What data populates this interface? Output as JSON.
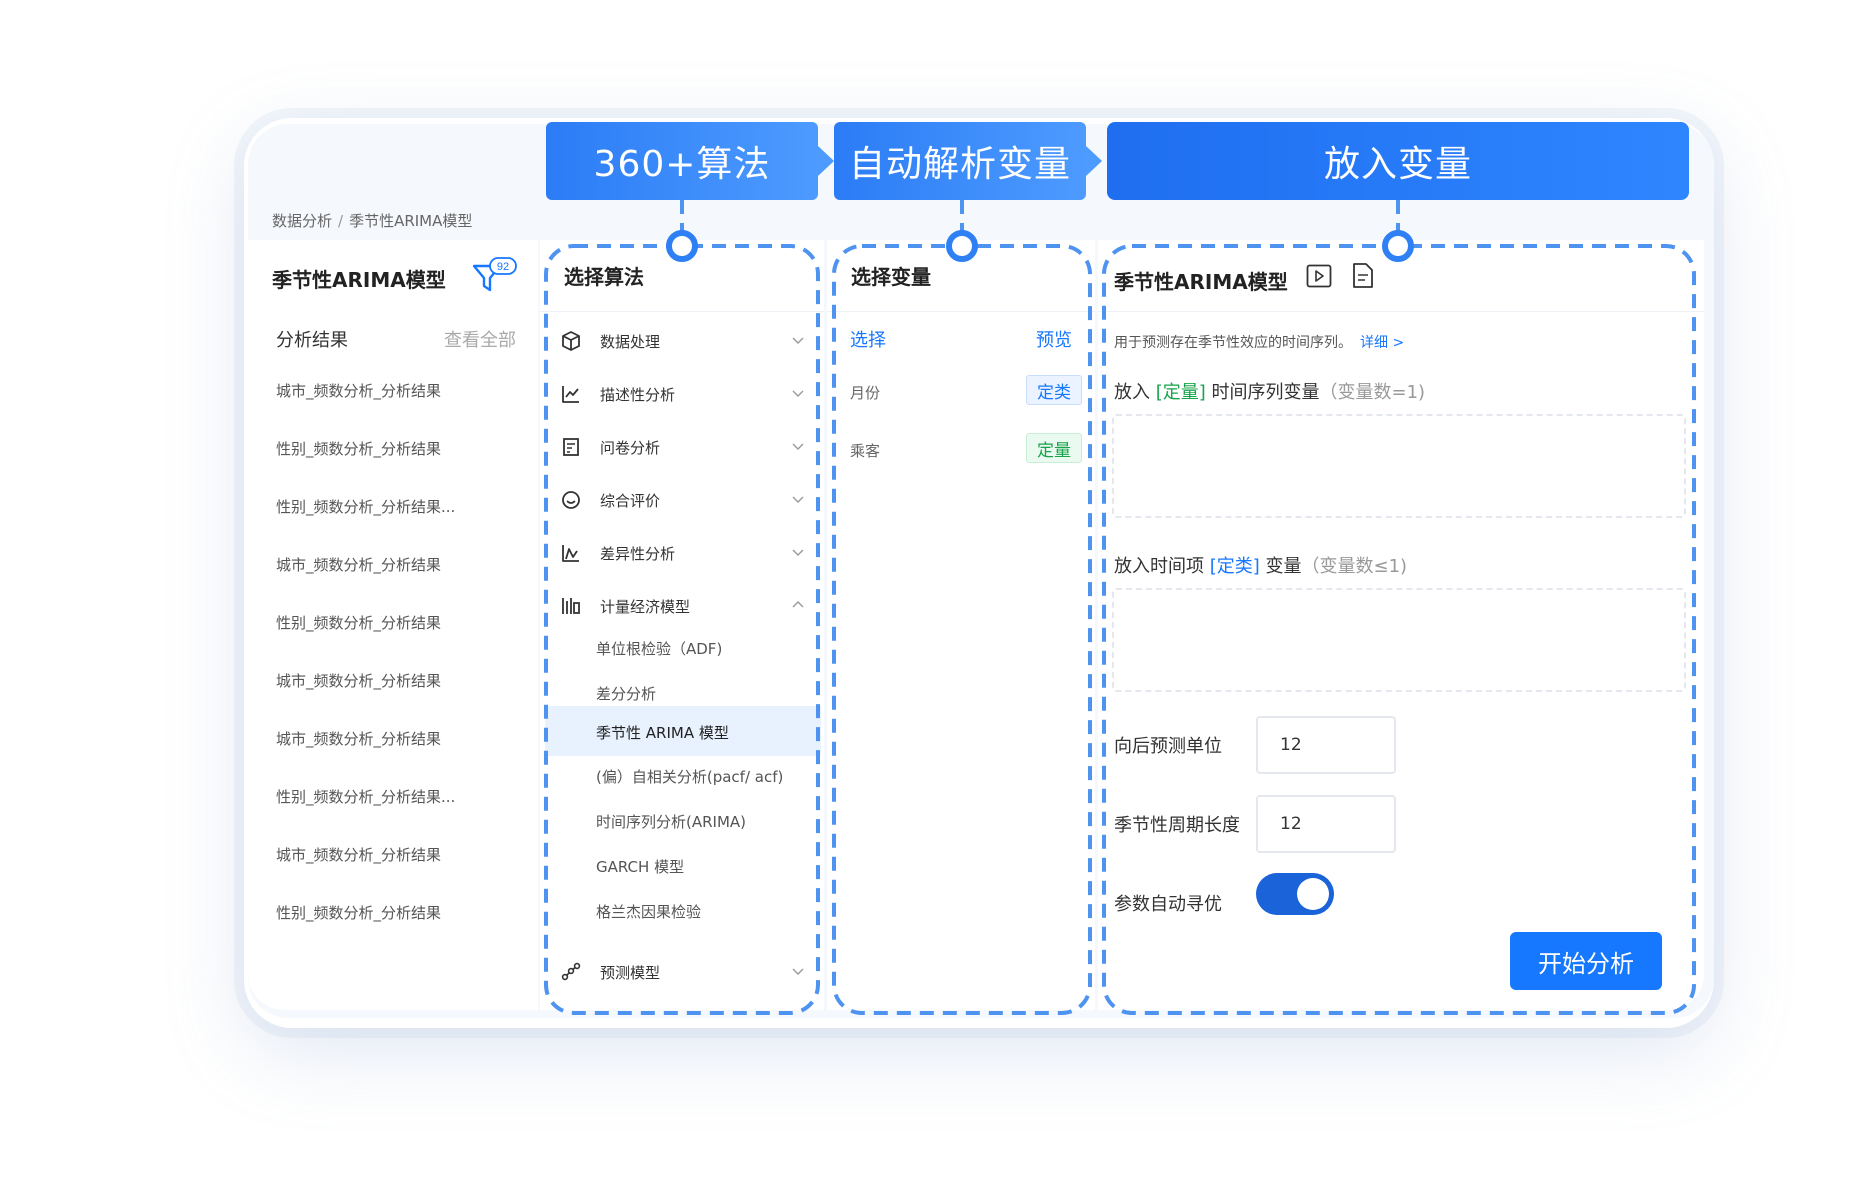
{
  "breadcrumb": {
    "root": "数据分析",
    "separator": "/",
    "current": "季节性ARIMA模型"
  },
  "banners": [
    "360+算法",
    "自动解析变量",
    "放入变量"
  ],
  "left": {
    "title": "季节性ARIMA模型",
    "badge": "92",
    "subtitle": "分析结果",
    "view_all": "查看全部",
    "items": [
      "城市_频数分析_分析结果",
      "性别_频数分析_分析结果",
      "性别_频数分析_分析结果...",
      "城市_频数分析_分析结果",
      "性别_频数分析_分析结果",
      "城市_频数分析_分析结果",
      "城市_频数分析_分析结果",
      "性别_频数分析_分析结果...",
      "城市_频数分析_分析结果",
      "性别_频数分析_分析结果"
    ]
  },
  "algorithms": {
    "title": "选择算法",
    "groups": [
      {
        "label": "数据处理",
        "icon": "cube-icon"
      },
      {
        "label": "描述性分析",
        "icon": "line-chart-icon"
      },
      {
        "label": "问卷分析",
        "icon": "questionnaire-icon"
      },
      {
        "label": "综合评价",
        "icon": "chat-icon"
      },
      {
        "label": "差异性分析",
        "icon": "difference-icon"
      },
      {
        "label": "计量经济模型",
        "icon": "econometrics-icon"
      }
    ],
    "sub_items": [
      "单位根检验（ADF)",
      "差分分析",
      "季节性 ARIMA 模型",
      "(偏）自相关分析(pacf/ acf)",
      "时间序列分析(ARIMA)",
      "GARCH 模型",
      "格兰杰因果检验"
    ],
    "last_group": {
      "label": "预测模型",
      "icon": "scatter-icon"
    }
  },
  "variables": {
    "title": "选择变量",
    "select": "选择",
    "preview": "预览",
    "items": [
      {
        "name": "月份",
        "tag": "定类"
      },
      {
        "name": "乘客",
        "tag": "定量"
      }
    ]
  },
  "main": {
    "title": "季节性ARIMA模型",
    "description": "用于预测存在季节性效应的时间序列。",
    "detail_link": "详细 >",
    "zone1": {
      "prefix": "放入",
      "tag": "[定量]",
      "label": "时间序列变量",
      "hint": "（变量数=1)"
    },
    "zone2": {
      "prefix": "放入时间项",
      "tag": "[定类]",
      "label": "变量",
      "hint": "（变量数≤1)"
    },
    "forecast_label": "向后预测单位",
    "forecast_value": "12",
    "season_label": "季节性周期长度",
    "season_value": "12",
    "auto_label": "参数自动寻优",
    "auto_on": true,
    "start_button": "开始分析"
  },
  "colors": {
    "accent": "#1677ff",
    "green": "#17a34a",
    "dash": "#4f93f0"
  }
}
